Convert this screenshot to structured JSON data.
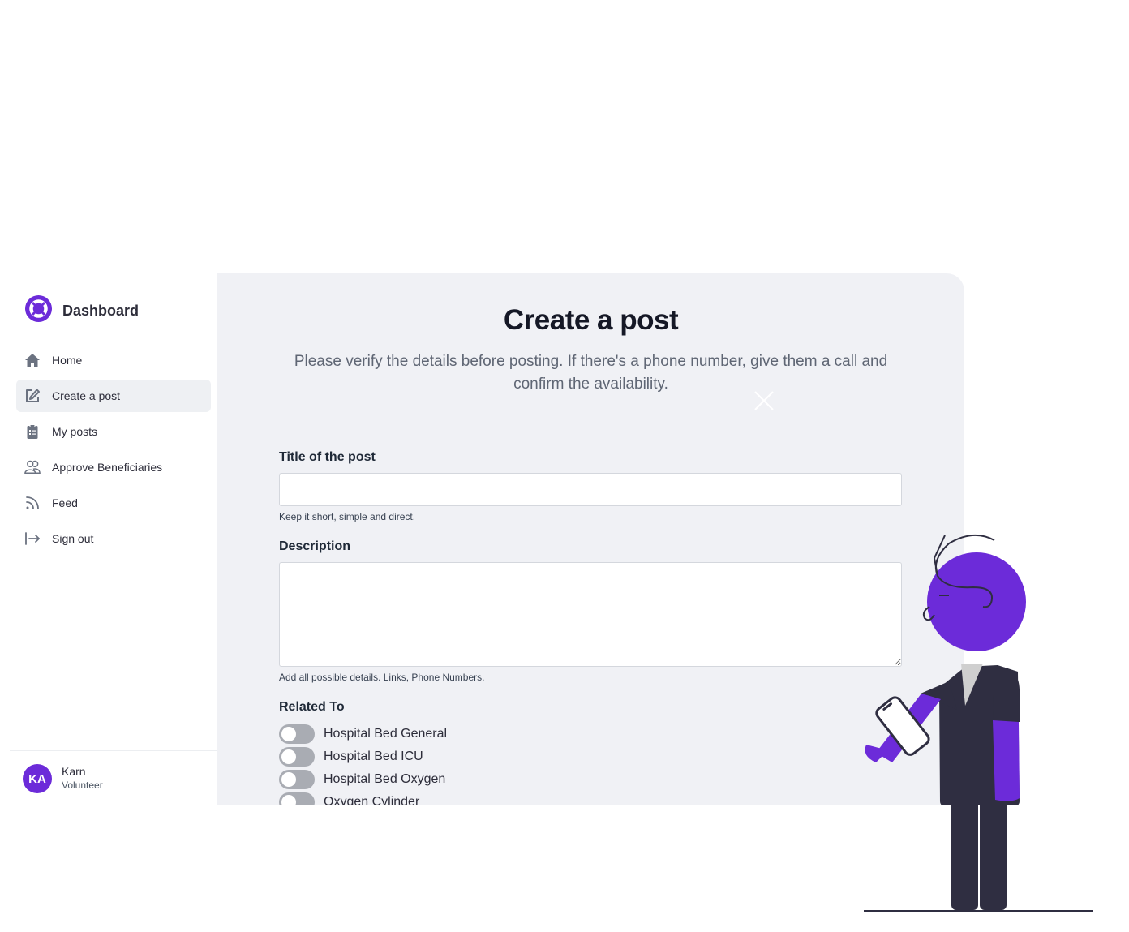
{
  "sidebar": {
    "brand_title": "Dashboard",
    "nav": [
      {
        "label": "Home",
        "icon": "home-icon",
        "active": false
      },
      {
        "label": "Create a post",
        "icon": "edit-icon",
        "active": true
      },
      {
        "label": "My posts",
        "icon": "clipboard-icon",
        "active": false
      },
      {
        "label": "Approve Beneficiaries",
        "icon": "users-icon",
        "active": false
      },
      {
        "label": "Feed",
        "icon": "rss-icon",
        "active": false
      },
      {
        "label": "Sign out",
        "icon": "sign-out-icon",
        "active": false
      }
    ],
    "user": {
      "initials": "KA",
      "name": "Karn",
      "role": "Volunteer"
    }
  },
  "main": {
    "title": "Create a post",
    "subtitle": "Please verify the details before posting. If there's a phone number, give them a call and confirm the availability.",
    "form": {
      "title_label": "Title of the post",
      "title_value": "",
      "title_help": "Keep it short, simple and direct.",
      "description_label": "Description",
      "description_value": "",
      "description_help": "Add all possible details. Links, Phone Numbers.",
      "related_label": "Related To",
      "related_options": [
        {
          "label": "Hospital Bed General",
          "checked": false
        },
        {
          "label": "Hospital Bed ICU",
          "checked": false
        },
        {
          "label": "Hospital Bed Oxygen",
          "checked": false
        },
        {
          "label": "Oxygen Cylinder",
          "checked": false
        }
      ]
    }
  },
  "colors": {
    "accent": "#6c2bd9",
    "panel_bg": "#f0f1f5",
    "figure_dark": "#2f2e41"
  }
}
